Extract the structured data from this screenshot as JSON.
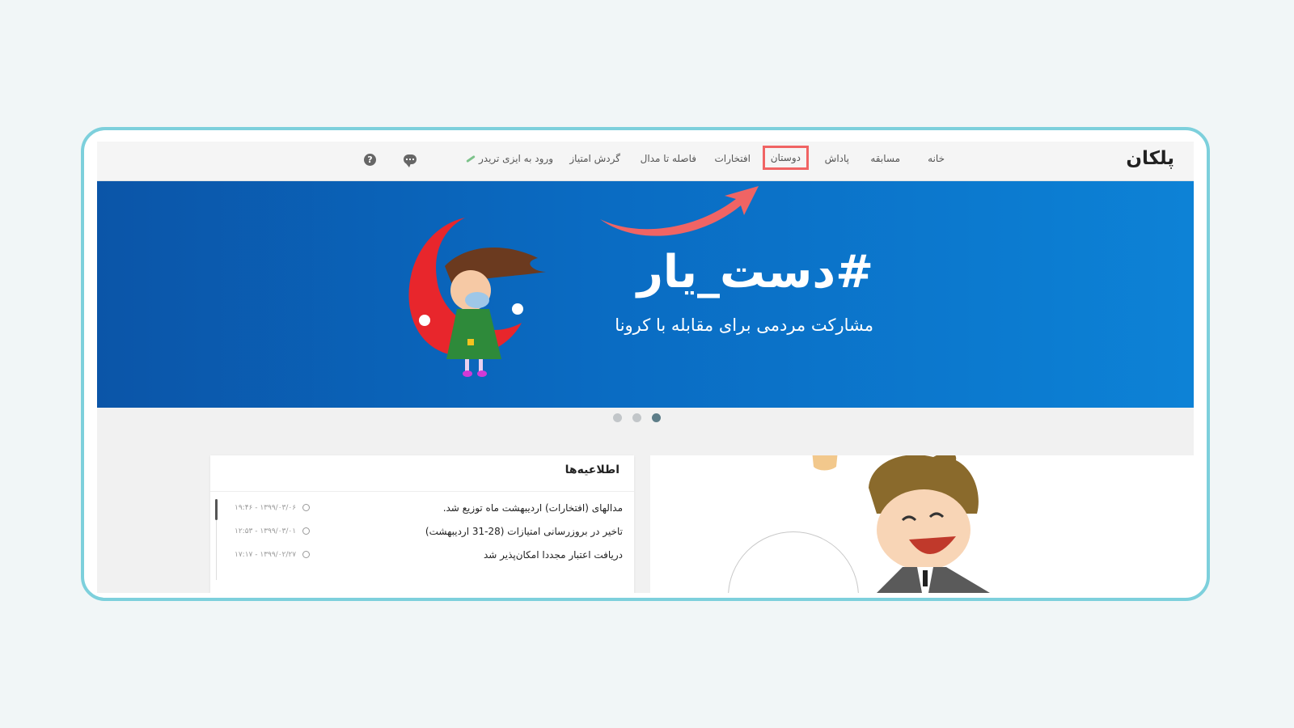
{
  "header": {
    "logo": "پلکان",
    "nav": [
      "خانه",
      "مسابقه",
      "پاداش",
      "دوستان",
      "افتخارات",
      "فاصله تا مدال",
      "گردش امتیاز",
      "ورود به ایزی تریدر"
    ],
    "highlighted_item": "دوستان",
    "icons": [
      "chat-icon",
      "help-icon"
    ]
  },
  "banner": {
    "title": "#دست_یار",
    "subtitle": "مشارکت مردمی برای مقابله با کرونا"
  },
  "carousel": {
    "count": 3,
    "active_index": 2
  },
  "notifications": {
    "title": "اطلاعیه‌ها",
    "items": [
      {
        "text": "مدالهای (افتخارات) اردیبهشت ماه توزیع شد.",
        "time": "۱۹:۴۶ - ۱۳۹۹/۰۳/۰۶"
      },
      {
        "text": "تاخیر در بروزرسانی امتیازات (28-31 اردیبهشت)",
        "time": "۱۲:۵۳ - ۱۳۹۹/۰۳/۰۱"
      },
      {
        "text": "دریافت اعتبار مجددا امکان‌پذیر شد",
        "time": "۱۷:۱۷ - ۱۳۹۹/۰۲/۲۷"
      }
    ]
  },
  "colors": {
    "frame": "#7dd0dc",
    "highlight": "#f06464",
    "banner": "#0a6bc2"
  }
}
